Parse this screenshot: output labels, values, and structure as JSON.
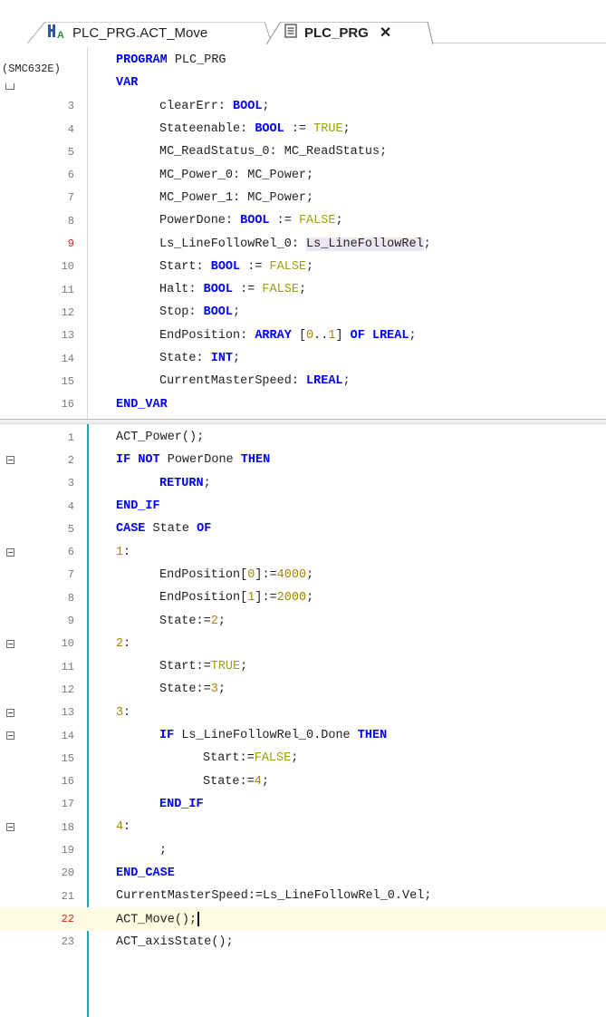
{
  "tabs": [
    {
      "label": "PLC_PRG.ACT_Move",
      "icon": "action-icon",
      "active": false
    },
    {
      "label": "PLC_PRG",
      "icon": "document-icon",
      "active": true,
      "close": "✕"
    }
  ],
  "declaration": {
    "ref_label": "(SMC632E)",
    "lines": [
      {
        "num": "",
        "text": "PROGRAM PLC_PRG"
      },
      {
        "num": "",
        "text": "VAR"
      },
      {
        "num": "3",
        "text": "clearErr: BOOL;"
      },
      {
        "num": "4",
        "text": "Stateenable: BOOL := TRUE;"
      },
      {
        "num": "5",
        "text": "MC_ReadStatus_0: MC_ReadStatus;"
      },
      {
        "num": "6",
        "text": "MC_Power_0: MC_Power;"
      },
      {
        "num": "7",
        "text": "MC_Power_1: MC_Power;"
      },
      {
        "num": "8",
        "text": "PowerDone: BOOL := FALSE;"
      },
      {
        "num": "9",
        "text": "Ls_LineFollowRel_0: Ls_LineFollowRel;"
      },
      {
        "num": "10",
        "text": "Start: BOOL := FALSE;"
      },
      {
        "num": "11",
        "text": "Halt: BOOL := FALSE;"
      },
      {
        "num": "12",
        "text": "Stop: BOOL;"
      },
      {
        "num": "13",
        "text": "EndPosition: ARRAY [0..1] OF LREAL;"
      },
      {
        "num": "14",
        "text": "State: INT;"
      },
      {
        "num": "15",
        "text": "CurrentMasterSpeed: LREAL;"
      },
      {
        "num": "16",
        "text": "END_VAR"
      }
    ]
  },
  "implementation": {
    "lines": [
      {
        "num": "1",
        "text": "ACT_Power();"
      },
      {
        "num": "2",
        "text": "IF NOT PowerDone THEN"
      },
      {
        "num": "3",
        "text": "RETURN;"
      },
      {
        "num": "4",
        "text": "END_IF"
      },
      {
        "num": "5",
        "text": "CASE State OF"
      },
      {
        "num": "6",
        "text": "1:"
      },
      {
        "num": "7",
        "text": "EndPosition[0]:=4000;"
      },
      {
        "num": "8",
        "text": "EndPosition[1]:=2000;"
      },
      {
        "num": "9",
        "text": "State:=2;"
      },
      {
        "num": "10",
        "text": "2:"
      },
      {
        "num": "11",
        "text": "Start:=TRUE;"
      },
      {
        "num": "12",
        "text": "State:=3;"
      },
      {
        "num": "13",
        "text": "3:"
      },
      {
        "num": "14",
        "text": "IF Ls_LineFollowRel_0.Done THEN"
      },
      {
        "num": "15",
        "text": "Start:=FALSE;"
      },
      {
        "num": "16",
        "text": "State:=4;"
      },
      {
        "num": "17",
        "text": "END_IF"
      },
      {
        "num": "18",
        "text": "4:"
      },
      {
        "num": "19",
        "text": ";"
      },
      {
        "num": "20",
        "text": "END_CASE"
      },
      {
        "num": "21",
        "text": "CurrentMasterSpeed:=Ls_LineFollowRel_0.Vel;"
      },
      {
        "num": "22",
        "text": "ACT_Move();"
      },
      {
        "num": "23",
        "text": "ACT_axisState();"
      }
    ]
  },
  "colors": {
    "keyword": "#0000ff",
    "literal": "#9aa000",
    "number": "#a88400",
    "line_number": "#7a7a7a",
    "line_number_modified": "#d4251f",
    "change_bar": "#1ea4b4",
    "current_line": "#fffbe3"
  }
}
